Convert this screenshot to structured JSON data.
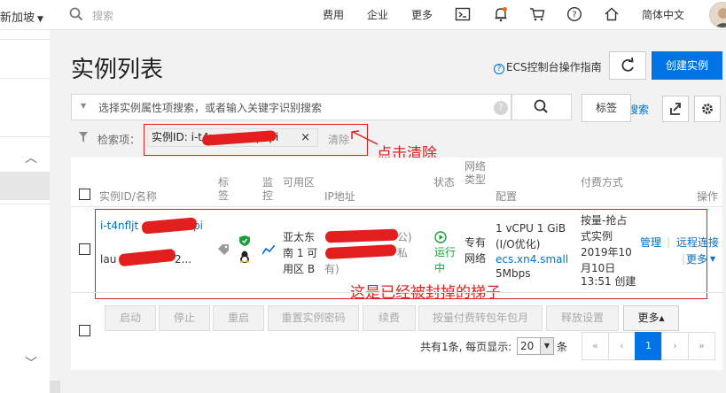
{
  "topbar": {
    "region": "新加坡",
    "search_placeholder": "搜索",
    "nav": [
      "费用",
      "企业",
      "更多"
    ],
    "language": "简体中文"
  },
  "icons": [
    "search-icon",
    "terminal-icon",
    "bell-icon",
    "cart-icon",
    "help-icon",
    "home-icon",
    "avatar-icon"
  ],
  "page": {
    "title": "实例列表",
    "guide_link": "ECS控制台操作指南",
    "create_button": "创建实例"
  },
  "search": {
    "placeholder": "选择实例属性项搜索，或者输入关键字识别搜索",
    "help": "?",
    "tag_button": "标签",
    "search_link": "搜索"
  },
  "filter": {
    "label": "检索项：",
    "chip_text": "实例ID: i-t4n",
    "chip_suffix": "mpxpi",
    "chip_close": "×",
    "clear": "清除",
    "annotation": "点击清除"
  },
  "table": {
    "headers": {
      "id": "实例ID/名称",
      "tag": "标\n签",
      "monitor": "监\n控",
      "zone": "可用区",
      "ip": "IP地址",
      "status": "状态",
      "nettype": "网络\n类型",
      "config": "配置",
      "billing": "付费方式",
      "action": "操作"
    },
    "rows": [
      {
        "id": "i-t4nfljt",
        "id_suffix": "pi",
        "name": "lau",
        "name_suffix": "2...",
        "zone": "亚太东南 1 可用区 B",
        "ip_line1_suffix": "公)",
        "ip_line2_suffix": "私",
        "ip_line3": "有)",
        "status": "运行中",
        "nettype": "专有网络",
        "config_line1": "1 vCPU 1 GiB",
        "config_line2": "(I/O优化)",
        "config_link": "ecs.xn4.small",
        "config_line4": "5Mbps",
        "billing": "按量-抢占式实例",
        "billing_date": "2019年10月10日",
        "billing_time": "13:51 创建",
        "action_manage": "管理",
        "action_remote": "远程连接",
        "action_more": "更多"
      }
    ],
    "row_annotation": "这是已经被封掉的梯子"
  },
  "bulk_actions": [
    "启动",
    "停止",
    "重启",
    "重置实例密码",
    "续费",
    "按量付费转包年包月",
    "释放设置"
  ],
  "bulk_more": "更多▴",
  "pager": {
    "summary": "共有1条, 每页显示:",
    "page_size": "20",
    "unit": "条",
    "pages": [
      "«",
      "‹",
      "1",
      "›",
      "»"
    ],
    "current": "1"
  }
}
